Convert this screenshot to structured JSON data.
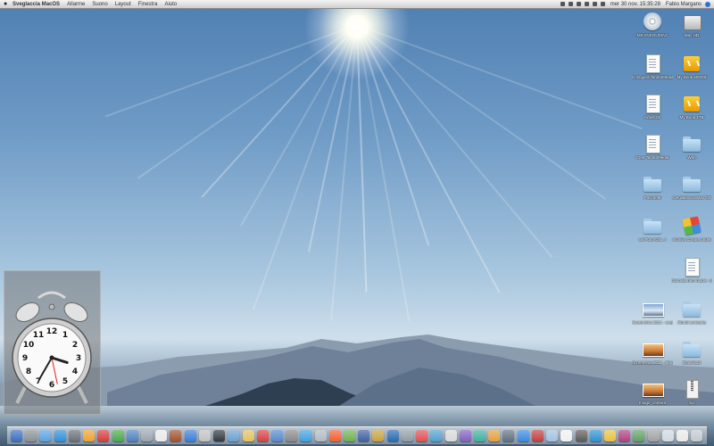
{
  "menubar": {
    "app_name": "Sveglaccia MacOS",
    "menus": [
      "Allarme",
      "Suono",
      "Layout",
      "Finestra",
      "Aiuto"
    ],
    "clock": "mer 30 nov. 15:35:28",
    "user": "Fabio Margans"
  },
  "desktop_icons": [
    {
      "label": "MS SVEGLIMAC",
      "icon": "disc-icon"
    },
    {
      "label": "Mac HD",
      "icon": "hard-drive-icon"
    },
    {
      "label": "Configura TarokoMedia",
      "icon": "document-icon"
    },
    {
      "label": "My Book 500GB",
      "icon": "usb-drive-icon"
    },
    {
      "label": "Arbeit.rtx",
      "icon": "document-icon"
    },
    {
      "label": "My Book 1TB",
      "icon": "usb-drive-icon"
    },
    {
      "label": "Crea TarokoMedia",
      "icon": "document-icon"
    },
    {
      "label": "Web",
      "icon": "folder-icon"
    },
    {
      "label": "Pacchetti",
      "icon": "folder-icon"
    },
    {
      "label": "sveglialaccia-Mac OS",
      "icon": "folder-icon"
    },
    {
      "label": "sw Foto (Ulti...)",
      "icon": "folder-icon"
    },
    {
      "label": "Archivio Creare under",
      "icon": "app-icon"
    },
    {
      "label": "Giornale.ring Image - jpeg",
      "icon": "document-icon"
    },
    {
      "label": "Screenshot 2011 - sveglia",
      "icon": "photo-icon"
    },
    {
      "label": "Sfondi scrivania",
      "icon": "folder-icon"
    },
    {
      "label": "Screenshot 2011 - MacOS",
      "icon": "photo-warm-icon"
    },
    {
      "label": "Download",
      "icon": "folder-icon"
    },
    {
      "label": "Image_camera",
      "icon": "photo-warm-icon"
    },
    {
      "label": "zip",
      "icon": "zip-icon"
    }
  ],
  "clock_widget": {
    "numerals": [
      "12",
      "1",
      "2",
      "3",
      "4",
      "5",
      "6",
      "7",
      "8",
      "9",
      "10",
      "11"
    ],
    "hour": 3,
    "minute": 35,
    "second": 28
  },
  "dock": {
    "colors": [
      "#3a6ec4",
      "#8a8f96",
      "#5aa0e0",
      "#2f8fd8",
      "#6a6f76",
      "#f0a030",
      "#d43d3d",
      "#4aa84a",
      "#5080c0",
      "#9aa3ac",
      "#e8e8e8",
      "#a0522d",
      "#3b7dd8",
      "#c0c0c0",
      "#303840",
      "#6aa0d0",
      "#e0c060",
      "#d84040",
      "#5588cc",
      "#888888",
      "#40a0e0",
      "#b0b8c0",
      "#f06030",
      "#70b050",
      "#4060a0",
      "#c8a040",
      "#2a6ab0",
      "#909aa4",
      "#e05050",
      "#50a0d0",
      "#d8d8d8",
      "#8060c0",
      "#40b0a0",
      "#e0a040",
      "#607080",
      "#3a88e0",
      "#c04040",
      "#a0c0e0",
      "#f0f0f0",
      "#5a5a5a",
      "#3090d0",
      "#e8c040",
      "#b04080",
      "#60a060",
      "#a0a0a0",
      "#d0d8e0",
      "#e8e8e8",
      "#c0c8d0"
    ]
  }
}
